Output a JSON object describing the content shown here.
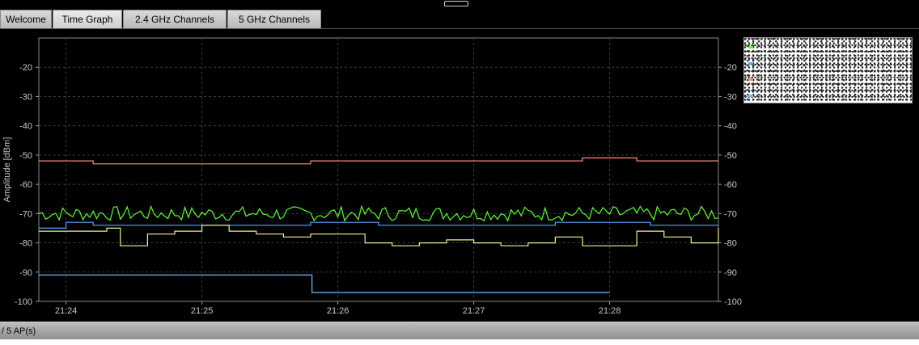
{
  "tabs": [
    {
      "label": "Welcome",
      "active": false
    },
    {
      "label": "Time Graph",
      "active": true
    },
    {
      "label": "2.4 GHz Channels",
      "active": false
    },
    {
      "label": "5 GHz Channels",
      "active": false
    }
  ],
  "status": {
    "text": "/ 5 AP(s)"
  },
  "chart_data": {
    "type": "line",
    "ylabel": "Amplitude [dBm]",
    "ylim": [
      -100,
      -10
    ],
    "yticks": [
      -20,
      -30,
      -40,
      -50,
      -60,
      -70,
      -80,
      -90,
      -100
    ],
    "xlim": [
      "21:23.8",
      "21:28.8"
    ],
    "xticks": [
      "21:24",
      "21:25",
      "21:26",
      "21:27",
      "21:28"
    ],
    "grid": true,
    "colors": {
      "salmon": "#ff8a7a",
      "green": "#58ff2e",
      "blue": "#5aa8ff",
      "yellow": "#f6f08a",
      "lightblue": "#6fb8ff"
    },
    "series": [
      {
        "color": "salmon",
        "x": [
          0,
          0.4,
          1,
          1.5,
          2,
          2.4,
          3,
          3.4,
          3.6,
          3.8,
          4,
          4.4,
          4.8,
          5
        ],
        "y": [
          -52,
          -53,
          -53,
          -53,
          -52,
          -52,
          -52,
          -52,
          -52,
          -52,
          -51,
          -52,
          -52,
          -52
        ]
      },
      {
        "color": "green",
        "x": [
          0,
          5
        ],
        "y": [
          -70,
          -70
        ]
      },
      {
        "color": "blue",
        "x": [
          0,
          0.2,
          0.4,
          1,
          1.4,
          2,
          2.5,
          3,
          3.5,
          3.8,
          4,
          4.5,
          5
        ],
        "y": [
          -75,
          -73,
          -74,
          -74,
          -74,
          -73,
          -74,
          -74,
          -74,
          -73,
          -73,
          -74,
          -74
        ]
      },
      {
        "color": "yellow",
        "x": [
          0,
          0.3,
          0.5,
          0.6,
          0.8,
          1,
          1.2,
          1.4,
          1.6,
          1.8,
          2,
          2.2,
          2.4,
          2.6,
          2.8,
          3,
          3.2,
          3.4,
          3.6,
          3.8,
          4,
          4.2,
          4.4,
          4.6,
          4.8,
          5
        ],
        "y": [
          -76,
          -76,
          -75,
          -81,
          -77,
          -76,
          -74,
          -76,
          -77,
          -78,
          -77,
          -77,
          -80,
          -81,
          -80,
          -79,
          -80,
          -81,
          -80,
          -78,
          -81,
          -81,
          -76,
          -78,
          -80,
          -75
        ]
      },
      {
        "color": "lightblue",
        "x": [
          0,
          1.5,
          2.01,
          4.2
        ],
        "y": [
          -91,
          -91,
          -97,
          -97
        ]
      }
    ]
  }
}
